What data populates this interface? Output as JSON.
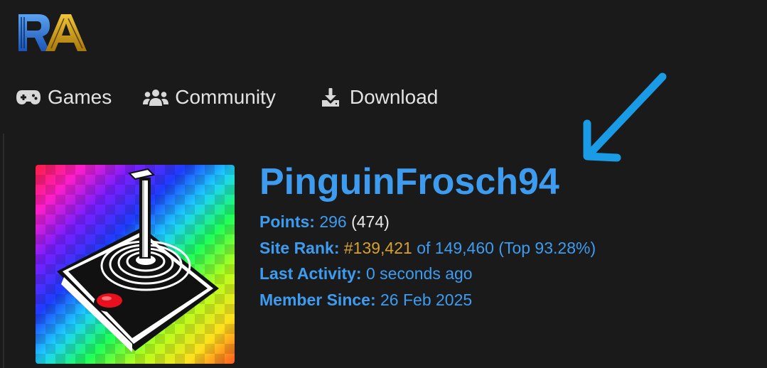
{
  "logo": {
    "text": "RA",
    "colors": {
      "r": "#2f6fd4",
      "a": "#d4a017"
    }
  },
  "nav": {
    "items": [
      {
        "label": "Games",
        "icon": "gamepad-icon"
      },
      {
        "label": "Community",
        "icon": "users-icon"
      },
      {
        "label": "Download",
        "icon": "download-icon"
      }
    ]
  },
  "profile": {
    "username": "PinguinFrosch94",
    "points_label": "Points:",
    "points_value": "296",
    "points_extra": "(474)",
    "rank_label": "Site Rank:",
    "rank_value": "#139,421",
    "rank_of": "of 149,460 (Top 93.28%)",
    "activity_label": "Last Activity:",
    "activity_value": "0 seconds ago",
    "member_label": "Member Since:",
    "member_value": "26 Feb 2025"
  },
  "avatar": {
    "icon": "joystick-icon"
  },
  "annotation": {
    "icon": "arrow-pointer-icon",
    "color": "#1a9be6"
  },
  "colors": {
    "background": "#1a1a1a",
    "link": "#3d9cf0",
    "text": "#e8e8e8",
    "gold": "#d6a12c"
  }
}
